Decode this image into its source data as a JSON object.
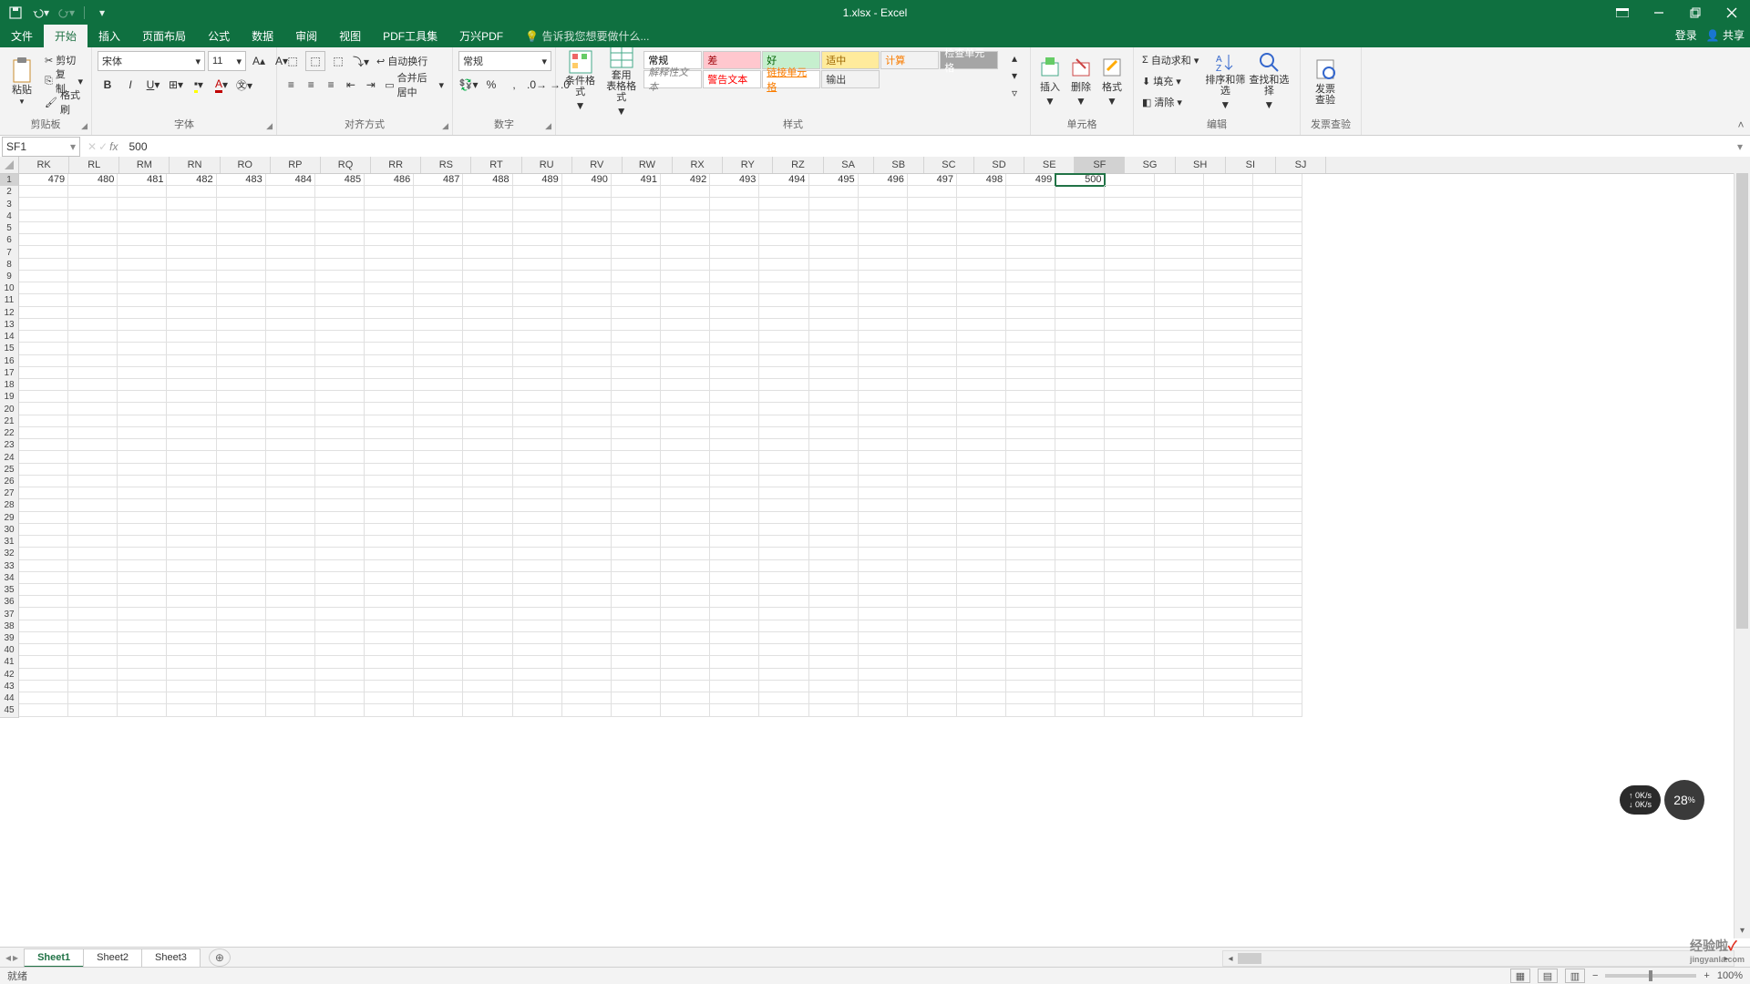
{
  "title": "1.xlsx - Excel",
  "qat": {
    "save": "保存",
    "undo": "撤销",
    "redo": "重做"
  },
  "login": "登录",
  "share": "共享",
  "tabs": [
    "文件",
    "开始",
    "插入",
    "页面布局",
    "公式",
    "数据",
    "审阅",
    "视图",
    "PDF工具集",
    "万兴PDF"
  ],
  "activeTab": 1,
  "tellme": "告诉我您想要做什么...",
  "ribbon": {
    "clipboard": {
      "paste": "粘贴",
      "cut": "剪切",
      "copy": "复制",
      "painter": "格式刷",
      "label": "剪贴板"
    },
    "font": {
      "name": "宋体",
      "size": "11",
      "label": "字体"
    },
    "align": {
      "wrap": "自动换行",
      "merge": "合并后居中",
      "label": "对齐方式"
    },
    "number": {
      "format": "常规",
      "label": "数字"
    },
    "styles": {
      "cond": "条件格式",
      "table": "套用\n表格格式",
      "gallery": [
        {
          "t": "常规",
          "bg": "#ffffff",
          "c": "#000"
        },
        {
          "t": "差",
          "bg": "#ffc7ce",
          "c": "#9c0006"
        },
        {
          "t": "好",
          "bg": "#c6efce",
          "c": "#006100"
        },
        {
          "t": "适中",
          "bg": "#ffeb9c",
          "c": "#9c6500"
        },
        {
          "t": "计算",
          "bg": "#f2f2f2",
          "c": "#fa7d00"
        },
        {
          "t": "检查单元格",
          "bg": "#a5a5a5",
          "c": "#ffffff"
        },
        {
          "t": "解释性文本",
          "bg": "#ffffff",
          "c": "#7f7f7f"
        },
        {
          "t": "警告文本",
          "bg": "#ffffff",
          "c": "#ff0000"
        },
        {
          "t": "链接单元格",
          "bg": "#ffffff",
          "c": "#fa7d00"
        },
        {
          "t": "输出",
          "bg": "#f2f2f2",
          "c": "#3f3f3f"
        }
      ],
      "label": "样式"
    },
    "cells": {
      "insert": "插入",
      "delete": "删除",
      "format": "格式",
      "label": "单元格"
    },
    "editing": {
      "sum": "自动求和",
      "fill": "填充",
      "clear": "清除",
      "sort": "排序和筛选",
      "find": "查找和选择",
      "label": "编辑"
    },
    "invoice": {
      "btn": "发票\n查验",
      "label": "发票查验"
    }
  },
  "namebox": "SF1",
  "formula": "500",
  "columns": [
    "RK",
    "RL",
    "RM",
    "RN",
    "RO",
    "RP",
    "RQ",
    "RR",
    "RS",
    "RT",
    "RU",
    "RV",
    "RW",
    "RX",
    "RY",
    "RZ",
    "SA",
    "SB",
    "SC",
    "SD",
    "SE",
    "SF",
    "SG",
    "SH",
    "SI",
    "SJ"
  ],
  "row1": [
    479,
    480,
    481,
    482,
    483,
    484,
    485,
    486,
    487,
    488,
    489,
    490,
    491,
    492,
    493,
    494,
    495,
    496,
    497,
    498,
    499,
    500,
    "",
    "",
    "",
    ""
  ],
  "activeCol": 21,
  "rowCount": 45,
  "sheets": [
    "Sheet1",
    "Sheet2",
    "Sheet3"
  ],
  "activeSheet": 0,
  "status": "就绪",
  "zoom": "100%",
  "net": {
    "up": "0K/s",
    "down": "0K/s",
    "pct": "28"
  },
  "watermark": {
    "t1": "经验啦",
    "t2": "jingyanla.com"
  }
}
